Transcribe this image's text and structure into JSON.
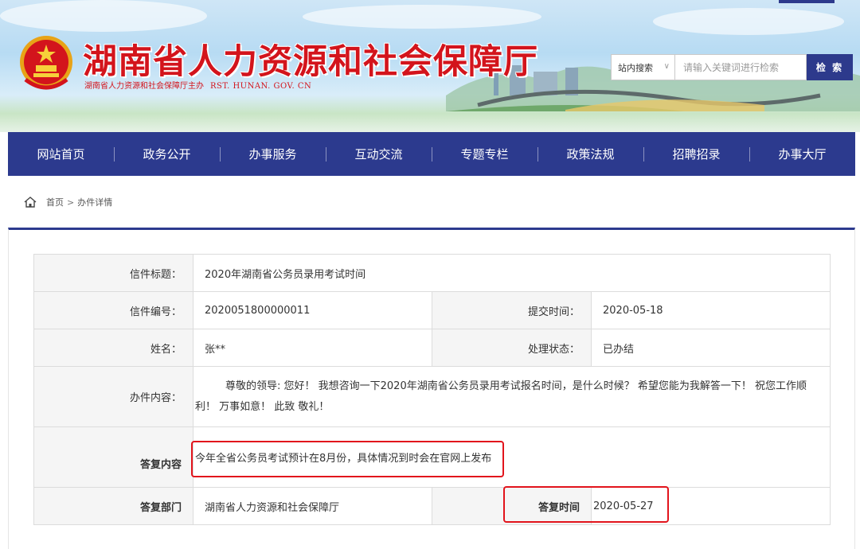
{
  "header": {
    "title": "湖南省人力资源和社会保障厅",
    "subtitle": "湖南省人力资源和社会保障厅主办",
    "domain": "RST. HUNAN. GOV. CN",
    "emblem_icon": "national-emblem-icon",
    "search": {
      "scope": "站内搜索",
      "placeholder": "请输入关键词进行检索",
      "button": "检 索"
    }
  },
  "nav": {
    "items": [
      "网站首页",
      "政务公开",
      "办事服务",
      "互动交流",
      "专题专栏",
      "政策法规",
      "招聘招录",
      "办事大厅"
    ]
  },
  "breadcrumb": {
    "home": "首页",
    "separator": ">",
    "current": "办件详情"
  },
  "detail": {
    "title_label": "信件标题：",
    "title_value": "2020年湖南省公务员录用考试时间",
    "number_label": "信件编号：",
    "number_value": "2020051800000011",
    "submit_label": "提交时间：",
    "submit_value": "2020-05-18",
    "name_label": "姓名：",
    "name_value": "张**",
    "status_label": "处理状态：",
    "status_value": "已办结",
    "content_label": "办件内容：",
    "content_value": "尊敬的领导: 您好！ 我想咨询一下2020年湖南省公务员录用考试报名时间，是什么时候？ 希望您能为我解答一下！ 祝您工作顺利！ 万事如意！ 此致 敬礼！",
    "reply_label": "答复内容",
    "reply_value": "今年全省公务员考试预计在8月份，具体情况到时会在官网上发布",
    "dept_label": "答复部门",
    "dept_value": "湖南省人力资源和社会保障厅",
    "reply_time_label": "答复时间",
    "reply_time_value": "2020-05-27"
  },
  "colors": {
    "nav_bg": "#2c3a8e",
    "title_red": "#d3141c",
    "highlight_red": "#e2141c"
  }
}
